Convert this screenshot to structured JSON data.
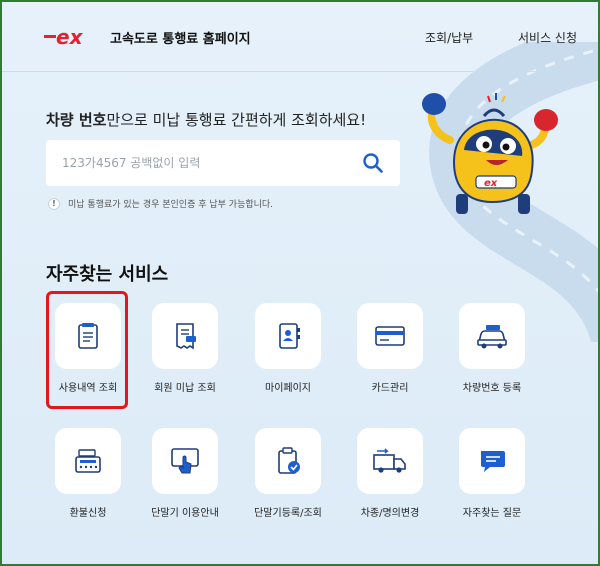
{
  "header": {
    "logo_text": "ex",
    "site_title": "고속도로 통행료 홈페이지",
    "nav": [
      "조회/납부",
      "서비스 신청"
    ]
  },
  "headline": {
    "bold": "차량 번호",
    "rest": "만으로 미납 통행료 간편하게 조회하세요!"
  },
  "search": {
    "placeholder": "123가4567 공백없이 입력",
    "value": ""
  },
  "notice": {
    "icon": "!",
    "text": "미납 통행료가 있는 경우 본인인증 후 납부 가능합니다."
  },
  "section_title": "자주찾는 서비스",
  "services": [
    {
      "label": "사용내역 조회",
      "icon": "document-icon"
    },
    {
      "label": "회원 미납 조회",
      "icon": "receipt-icon"
    },
    {
      "label": "마이페이지",
      "icon": "contact-book-icon"
    },
    {
      "label": "카드관리",
      "icon": "card-icon"
    },
    {
      "label": "차량번호 등록",
      "icon": "car-icon"
    },
    {
      "label": "환불신청",
      "icon": "cash-register-icon"
    },
    {
      "label": "단말기 이용안내",
      "icon": "touch-screen-icon"
    },
    {
      "label": "단말기등록/조회",
      "icon": "clipboard-check-icon"
    },
    {
      "label": "차종/명의변경",
      "icon": "truck-icon"
    },
    {
      "label": "자주찾는 질문",
      "icon": "chat-icon"
    }
  ],
  "colors": {
    "brand_red": "#e4212c",
    "accent_blue": "#1d5fd1",
    "highlight_red": "#e01818",
    "background": "#dcebf7"
  }
}
